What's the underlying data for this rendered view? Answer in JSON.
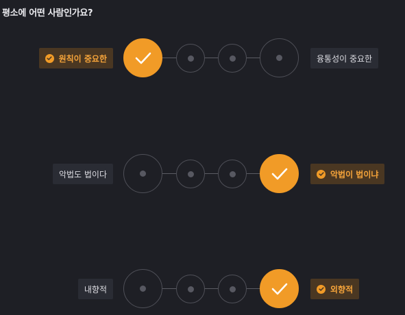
{
  "question": "평소에 어떤 사람인가요?",
  "colors": {
    "accent": "#f19b27",
    "selected_label_bg": "#4a3722",
    "background": "#1e1f25"
  },
  "rows": [
    {
      "left": "원칙이 중요한",
      "right": "융통성이 중요한",
      "selected_index": 0,
      "options": 4
    },
    {
      "left": "악법도 법이다",
      "right": "악법이 법이냐",
      "selected_index": 3,
      "options": 4
    },
    {
      "left": "내향적",
      "right": "외향적",
      "selected_index": 3,
      "options": 4
    }
  ]
}
